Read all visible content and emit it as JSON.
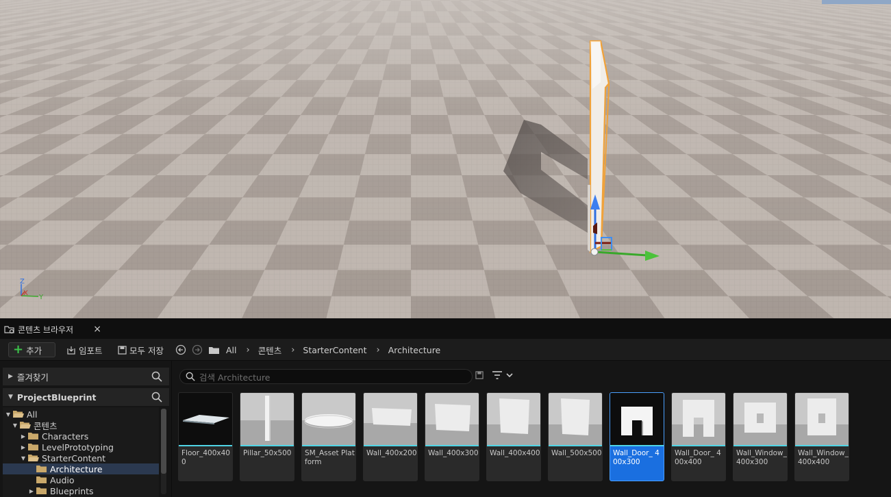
{
  "viewport": {
    "axis_labels": {
      "z": "Z",
      "x": "X",
      "y": "Y"
    }
  },
  "content_browser": {
    "tab_title": "콘텐츠 브라우저",
    "tab_close": "×",
    "toolbar": {
      "add_label": "추가",
      "import_label": "임포트",
      "save_all_label": "모두 저장"
    },
    "breadcrumb": [
      "All",
      "콘텐츠",
      "StarterContent",
      "Architecture"
    ],
    "sidebar": {
      "favorites_label": "즐겨찾기",
      "project_label": "ProjectBlueprint",
      "tree": [
        {
          "label": "All",
          "expanded": true
        },
        {
          "label": "콘텐츠",
          "expanded": true
        },
        {
          "label": "Characters",
          "expanded": false
        },
        {
          "label": "LevelPrototyping",
          "expanded": false
        },
        {
          "label": "StarterContent",
          "expanded": true
        },
        {
          "label": "Architecture",
          "selected": true
        },
        {
          "label": "Audio"
        },
        {
          "label": "Blueprints",
          "expanded": false
        }
      ]
    },
    "search": {
      "placeholder": "검색 Architecture"
    },
    "assets": [
      {
        "name": "Floor_400x400"
      },
      {
        "name": "Pillar_50x500"
      },
      {
        "name": "SM_Asset Platform"
      },
      {
        "name": "Wall_400x200"
      },
      {
        "name": "Wall_400x300"
      },
      {
        "name": "Wall_400x400"
      },
      {
        "name": "Wall_500x500"
      },
      {
        "name": "Wall_Door_ 400x300",
        "selected": true
      },
      {
        "name": "Wall_Door_ 400x400"
      },
      {
        "name": "Wall_Window_ 400x300"
      },
      {
        "name": "Wall_Window_ 400x400"
      }
    ],
    "colors": {
      "accent": "#1a6fe0",
      "asset_bar": "#4fd5e6",
      "add_icon": "#3cc24a"
    }
  }
}
